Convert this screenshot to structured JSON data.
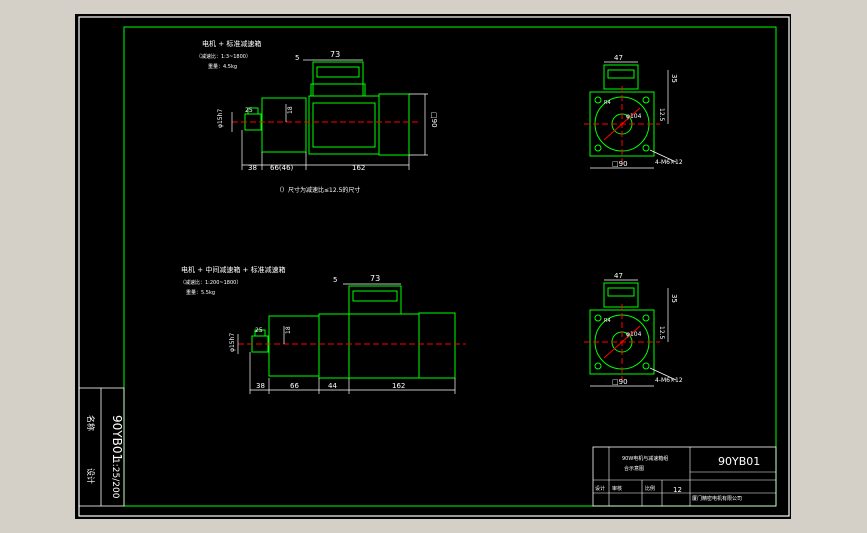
{
  "drawing": {
    "top_view1": {
      "title": "电机 + 标准减速箱",
      "ratio": "（减速比：1:3~1800）",
      "weight": "重量：4.5kg",
      "dims": {
        "d_shaft": "φ15h7",
        "w25": "25",
        "d18": "18",
        "d5": "5",
        "d73": "73",
        "d38": "38",
        "d66_46": "66(46)",
        "d162": "162",
        "d90": "□90"
      },
      "note": "（）尺寸为减速比≤12.5的尺寸"
    },
    "top_view2": {
      "title": "电机 + 中间减速箱 + 标准减速箱",
      "ratio": "（减速比：1:200~1800）",
      "weight": "重量：5.5kg",
      "dims": {
        "d_shaft": "φ15h7",
        "w25": "25",
        "d18": "18",
        "d5": "5",
        "d73": "73",
        "d38": "38",
        "d66": "66",
        "d44": "44",
        "d162": "162"
      }
    },
    "side_view1": {
      "dims": {
        "d47": "47",
        "d35": "35",
        "d12_5": "12.5",
        "d90": "□90",
        "d104": "φ104",
        "hole": "4-M6×12",
        "r": "R4"
      }
    },
    "side_view2": {
      "dims": {
        "d47": "47",
        "d35": "35",
        "d12_5": "12.5",
        "d90": "□90",
        "d104": "φ104",
        "hole": "4-M6×12",
        "r": "R4"
      }
    },
    "left_strip": {
      "code": "90YB01",
      "scale": "1:25/200",
      "label_top": "名称",
      "label_bottom": "设计"
    },
    "title_block": {
      "drawing_no": "90YB01",
      "description_line1": "90W电机与减速箱组",
      "description_line2": "合示意图",
      "sheet": "12",
      "company": "厦门精密电机有限公司",
      "row_labels": [
        "设计",
        "审核",
        "比例"
      ]
    }
  },
  "colors": {
    "background": "#000000",
    "frame_outer": "#ffffff",
    "frame_inner": "#00ff00",
    "geometry": "#00ff00",
    "dimension": "#ffffff",
    "centerline": "#ff0000"
  }
}
